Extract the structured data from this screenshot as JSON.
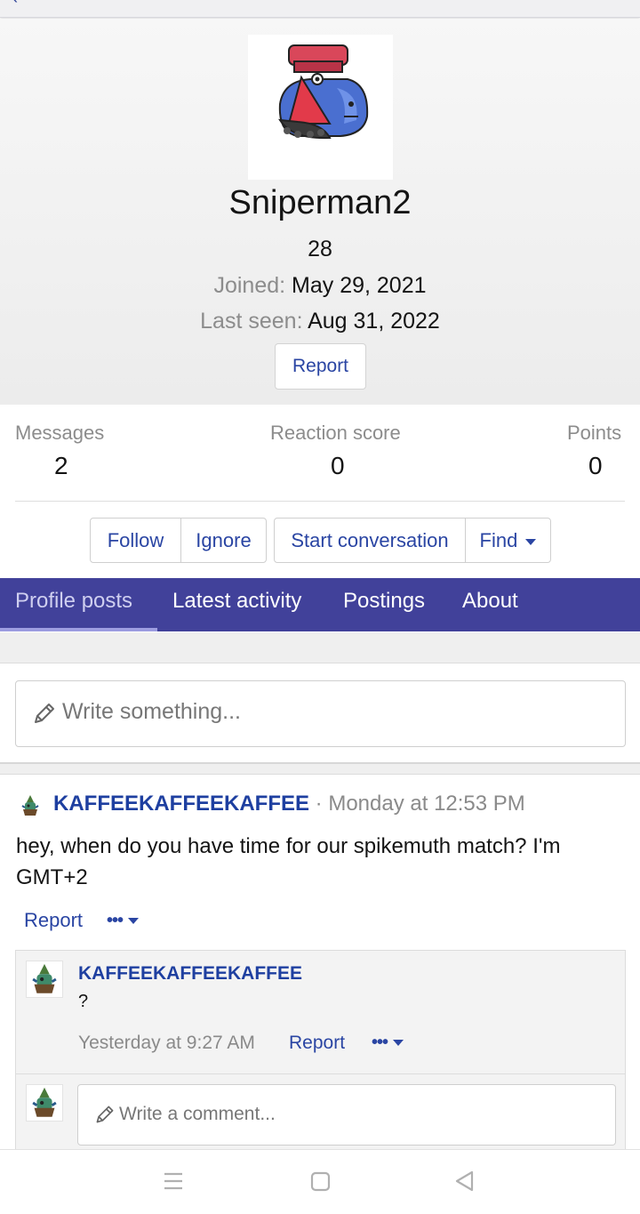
{
  "profile": {
    "username": "Sniperman2",
    "age": "28",
    "joined_label": "Joined:",
    "joined_value": "May 29, 2021",
    "last_seen_label": "Last seen:",
    "last_seen_value": "Aug 31, 2022",
    "report_label": "Report"
  },
  "stats": [
    {
      "label": "Messages",
      "value": "2"
    },
    {
      "label": "Reaction score",
      "value": "0"
    },
    {
      "label": "Points",
      "value": "0"
    }
  ],
  "actions": {
    "follow": "Follow",
    "ignore": "Ignore",
    "start_conversation": "Start conversation",
    "find": "Find"
  },
  "tabs": [
    {
      "label": "Profile posts",
      "active": true
    },
    {
      "label": "Latest activity",
      "active": false
    },
    {
      "label": "Postings",
      "active": false
    },
    {
      "label": "About",
      "active": false
    }
  ],
  "composer": {
    "placeholder": "Write something..."
  },
  "post": {
    "author": "KAFFEEKAFFEEKAFFEE",
    "separator": " · ",
    "time": "Monday at 12:53 PM",
    "body": "hey, when do you have time for our spikemuth match? I'm GMT+2",
    "report_label": "Report",
    "more_label": "•••"
  },
  "comment": {
    "author": "KAFFEEKAFFEEKAFFEE",
    "text": "?",
    "time": "Yesterday at 9:27 AM",
    "report_label": "Report",
    "more_label": "•••",
    "placeholder": "Write a comment..."
  },
  "colors": {
    "link": "#2a45a3",
    "tab_bar": "#41419a",
    "author": "#1e3fa0"
  },
  "icons": [
    "back-icon",
    "pencil-icon",
    "caret-down-icon",
    "menu-icon",
    "home-icon",
    "back-triangle-icon"
  ]
}
